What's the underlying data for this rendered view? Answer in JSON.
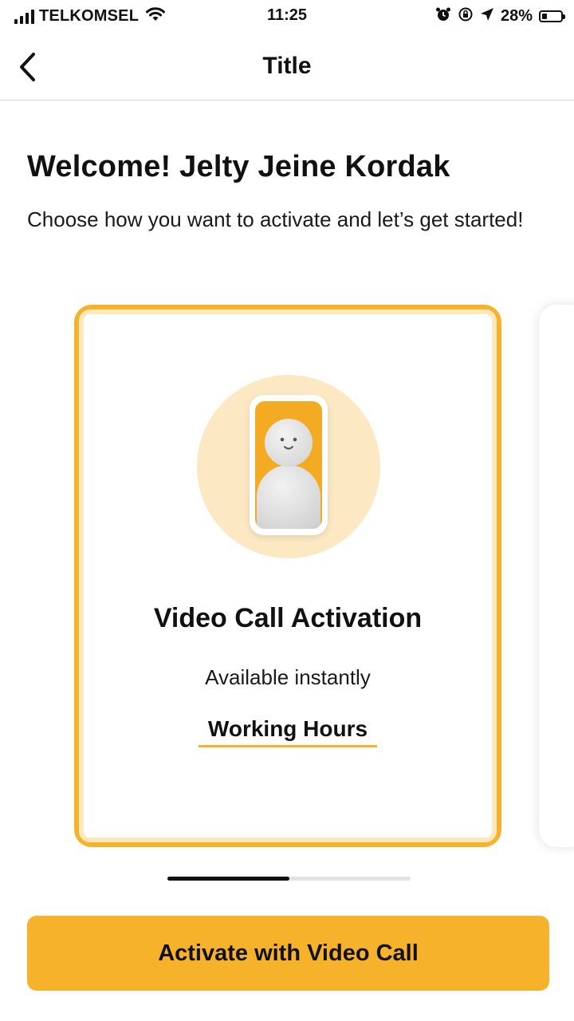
{
  "status_bar": {
    "carrier": "TELKOMSEL",
    "time": "11:25",
    "battery_percent": "28%",
    "battery_level": 0.28,
    "icons": [
      "signal-icon",
      "wifi-icon",
      "alarm-icon",
      "orientation-lock-icon",
      "location-icon",
      "battery-icon"
    ]
  },
  "nav": {
    "title": "Title",
    "back_icon": "chevron-left-icon"
  },
  "welcome": {
    "title": "Welcome! Jelty Jeine Kordak",
    "subtitle": "Choose how you want to activate and let’s get started!"
  },
  "cards": [
    {
      "title": "Video Call Activation",
      "subtitle": "Available instantly",
      "link": "Working Hours",
      "illustration": "person-in-phone-illustration"
    }
  ],
  "pager": {
    "current_page": 1,
    "total_pages": 2
  },
  "cta": {
    "label": "Activate with Video Call"
  },
  "colors": {
    "accent": "#f7b22b",
    "accent_light": "#fde8c4",
    "text": "#111111"
  }
}
